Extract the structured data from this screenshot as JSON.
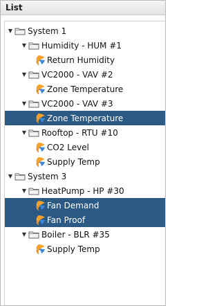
{
  "panel": {
    "title": "List"
  },
  "tree": {
    "icons": {
      "expander": "triangle-down-icon",
      "folder": "folder-icon",
      "point": "point-icon"
    },
    "nodes": [
      {
        "label": "System 1",
        "level": 0,
        "type": "folder",
        "expanded": true,
        "selected": false
      },
      {
        "label": "Humidity - HUM #1",
        "level": 1,
        "type": "folder",
        "expanded": true,
        "selected": false
      },
      {
        "label": "Return Humidity",
        "level": 2,
        "type": "point",
        "selected": false
      },
      {
        "label": "VC2000 - VAV #2",
        "level": 1,
        "type": "folder",
        "expanded": true,
        "selected": false
      },
      {
        "label": "Zone Temperature",
        "level": 2,
        "type": "point",
        "selected": false
      },
      {
        "label": "VC2000 - VAV #3",
        "level": 1,
        "type": "folder",
        "expanded": true,
        "selected": false
      },
      {
        "label": "Zone Temperature",
        "level": 2,
        "type": "point",
        "selected": true
      },
      {
        "label": "Rooftop - RTU #10",
        "level": 1,
        "type": "folder",
        "expanded": true,
        "selected": false
      },
      {
        "label": "CO2 Level",
        "level": 2,
        "type": "point",
        "selected": false
      },
      {
        "label": "Supply Temp",
        "level": 2,
        "type": "point",
        "selected": false
      },
      {
        "label": "System 3",
        "level": 0,
        "type": "folder",
        "expanded": true,
        "selected": false
      },
      {
        "label": "HeatPump - HP #30",
        "level": 1,
        "type": "folder",
        "expanded": true,
        "selected": false
      },
      {
        "label": "Fan Demand",
        "level": 2,
        "type": "point",
        "selected": true
      },
      {
        "label": "Fan Proof",
        "level": 2,
        "type": "point",
        "selected": true
      },
      {
        "label": "Boiler - BLR #35",
        "level": 1,
        "type": "folder",
        "expanded": true,
        "selected": false
      },
      {
        "label": "Supply Temp",
        "level": 2,
        "type": "point",
        "selected": false
      }
    ]
  }
}
